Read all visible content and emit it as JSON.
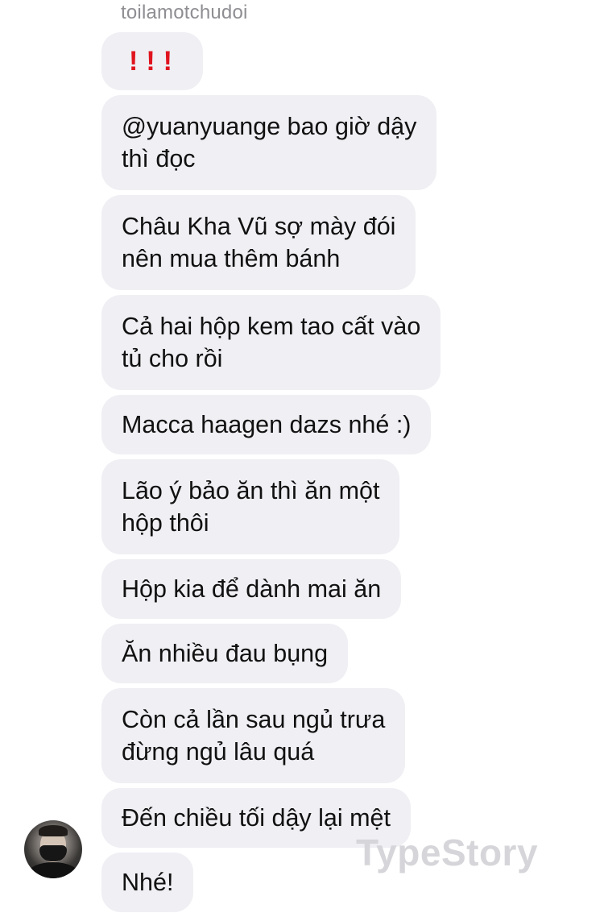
{
  "conversation": {
    "sender_name": "toilamotchudoi",
    "messages": [
      {
        "text": "!!!",
        "kind": "alert"
      },
      {
        "text": "@yuanyuange bao giờ dậy\nthì đọc",
        "kind": "text"
      },
      {
        "text": "Châu Kha Vũ sợ mày đói\nnên mua thêm bánh",
        "kind": "text"
      },
      {
        "text": "Cả hai hộp kem tao cất vào\ntủ cho rồi",
        "kind": "text"
      },
      {
        "text": "Macca haagen dazs nhé :)",
        "kind": "text"
      },
      {
        "text": "Lão ý bảo ăn thì ăn một\nhộp thôi",
        "kind": "text"
      },
      {
        "text": "Hộp kia để dành mai ăn",
        "kind": "text"
      },
      {
        "text": "Ăn nhiều đau bụng",
        "kind": "text"
      },
      {
        "text": "Còn cả lần sau ngủ trưa\nđừng ngủ lâu quá",
        "kind": "text"
      },
      {
        "text": "Đến chiều tối dậy lại mệt",
        "kind": "text"
      },
      {
        "text": "Nhé!",
        "kind": "text"
      }
    ],
    "avatar_icon": "user-avatar-photo",
    "alert_color": "#e0141e",
    "bubble_color": "#efeff4"
  },
  "watermark": {
    "text": "TypeStory"
  }
}
